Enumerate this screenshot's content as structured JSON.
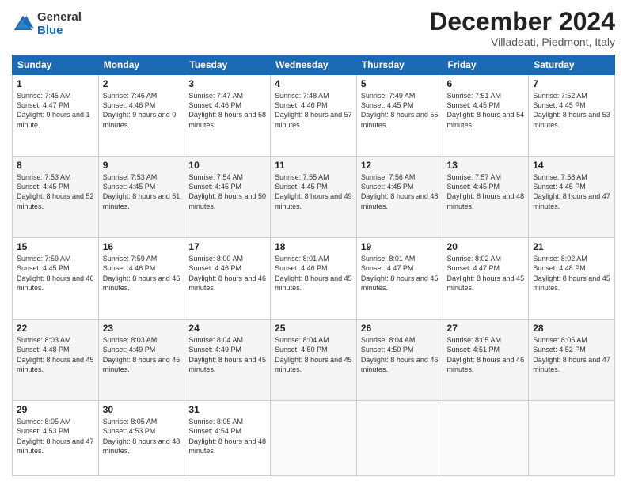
{
  "logo": {
    "general": "General",
    "blue": "Blue"
  },
  "title": "December 2024",
  "location": "Villadeati, Piedmont, Italy",
  "days_header": [
    "Sunday",
    "Monday",
    "Tuesday",
    "Wednesday",
    "Thursday",
    "Friday",
    "Saturday"
  ],
  "weeks": [
    [
      {
        "day": "1",
        "sunrise": "7:45 AM",
        "sunset": "4:47 PM",
        "daylight": "9 hours and 1 minute."
      },
      {
        "day": "2",
        "sunrise": "7:46 AM",
        "sunset": "4:46 PM",
        "daylight": "9 hours and 0 minutes."
      },
      {
        "day": "3",
        "sunrise": "7:47 AM",
        "sunset": "4:46 PM",
        "daylight": "8 hours and 58 minutes."
      },
      {
        "day": "4",
        "sunrise": "7:48 AM",
        "sunset": "4:46 PM",
        "daylight": "8 hours and 57 minutes."
      },
      {
        "day": "5",
        "sunrise": "7:49 AM",
        "sunset": "4:45 PM",
        "daylight": "8 hours and 55 minutes."
      },
      {
        "day": "6",
        "sunrise": "7:51 AM",
        "sunset": "4:45 PM",
        "daylight": "8 hours and 54 minutes."
      },
      {
        "day": "7",
        "sunrise": "7:52 AM",
        "sunset": "4:45 PM",
        "daylight": "8 hours and 53 minutes."
      }
    ],
    [
      {
        "day": "8",
        "sunrise": "7:53 AM",
        "sunset": "4:45 PM",
        "daylight": "8 hours and 52 minutes."
      },
      {
        "day": "9",
        "sunrise": "7:53 AM",
        "sunset": "4:45 PM",
        "daylight": "8 hours and 51 minutes."
      },
      {
        "day": "10",
        "sunrise": "7:54 AM",
        "sunset": "4:45 PM",
        "daylight": "8 hours and 50 minutes."
      },
      {
        "day": "11",
        "sunrise": "7:55 AM",
        "sunset": "4:45 PM",
        "daylight": "8 hours and 49 minutes."
      },
      {
        "day": "12",
        "sunrise": "7:56 AM",
        "sunset": "4:45 PM",
        "daylight": "8 hours and 48 minutes."
      },
      {
        "day": "13",
        "sunrise": "7:57 AM",
        "sunset": "4:45 PM",
        "daylight": "8 hours and 48 minutes."
      },
      {
        "day": "14",
        "sunrise": "7:58 AM",
        "sunset": "4:45 PM",
        "daylight": "8 hours and 47 minutes."
      }
    ],
    [
      {
        "day": "15",
        "sunrise": "7:59 AM",
        "sunset": "4:45 PM",
        "daylight": "8 hours and 46 minutes."
      },
      {
        "day": "16",
        "sunrise": "7:59 AM",
        "sunset": "4:46 PM",
        "daylight": "8 hours and 46 minutes."
      },
      {
        "day": "17",
        "sunrise": "8:00 AM",
        "sunset": "4:46 PM",
        "daylight": "8 hours and 46 minutes."
      },
      {
        "day": "18",
        "sunrise": "8:01 AM",
        "sunset": "4:46 PM",
        "daylight": "8 hours and 45 minutes."
      },
      {
        "day": "19",
        "sunrise": "8:01 AM",
        "sunset": "4:47 PM",
        "daylight": "8 hours and 45 minutes."
      },
      {
        "day": "20",
        "sunrise": "8:02 AM",
        "sunset": "4:47 PM",
        "daylight": "8 hours and 45 minutes."
      },
      {
        "day": "21",
        "sunrise": "8:02 AM",
        "sunset": "4:48 PM",
        "daylight": "8 hours and 45 minutes."
      }
    ],
    [
      {
        "day": "22",
        "sunrise": "8:03 AM",
        "sunset": "4:48 PM",
        "daylight": "8 hours and 45 minutes."
      },
      {
        "day": "23",
        "sunrise": "8:03 AM",
        "sunset": "4:49 PM",
        "daylight": "8 hours and 45 minutes."
      },
      {
        "day": "24",
        "sunrise": "8:04 AM",
        "sunset": "4:49 PM",
        "daylight": "8 hours and 45 minutes."
      },
      {
        "day": "25",
        "sunrise": "8:04 AM",
        "sunset": "4:50 PM",
        "daylight": "8 hours and 45 minutes."
      },
      {
        "day": "26",
        "sunrise": "8:04 AM",
        "sunset": "4:50 PM",
        "daylight": "8 hours and 46 minutes."
      },
      {
        "day": "27",
        "sunrise": "8:05 AM",
        "sunset": "4:51 PM",
        "daylight": "8 hours and 46 minutes."
      },
      {
        "day": "28",
        "sunrise": "8:05 AM",
        "sunset": "4:52 PM",
        "daylight": "8 hours and 47 minutes."
      }
    ],
    [
      {
        "day": "29",
        "sunrise": "8:05 AM",
        "sunset": "4:53 PM",
        "daylight": "8 hours and 47 minutes."
      },
      {
        "day": "30",
        "sunrise": "8:05 AM",
        "sunset": "4:53 PM",
        "daylight": "8 hours and 48 minutes."
      },
      {
        "day": "31",
        "sunrise": "8:05 AM",
        "sunset": "4:54 PM",
        "daylight": "8 hours and 48 minutes."
      },
      null,
      null,
      null,
      null
    ]
  ]
}
